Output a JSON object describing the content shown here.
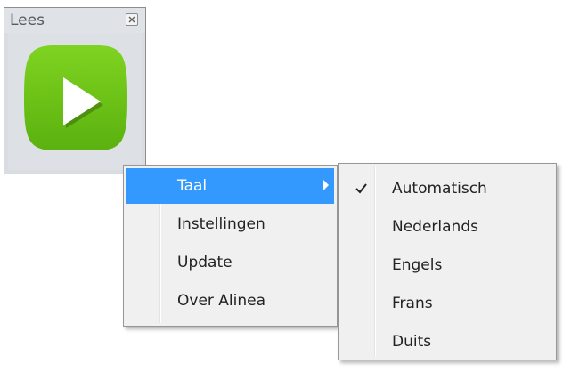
{
  "widget": {
    "title": "Lees",
    "icons": {
      "close": "close-icon",
      "play": "play-icon"
    },
    "colors": {
      "play_green": "#6cc314",
      "play_triangle": "#ffffff"
    }
  },
  "context_menu": {
    "items": [
      {
        "label": "Taal",
        "highlighted": true,
        "has_submenu": true
      },
      {
        "label": "Instellingen"
      },
      {
        "label": "Update"
      },
      {
        "label": "Over Alinea"
      }
    ],
    "highlight_color": "#3399ff"
  },
  "language_submenu": {
    "items": [
      {
        "label": "Automatisch",
        "checked": true
      },
      {
        "label": "Nederlands"
      },
      {
        "label": "Engels"
      },
      {
        "label": "Frans"
      },
      {
        "label": "Duits"
      }
    ]
  }
}
